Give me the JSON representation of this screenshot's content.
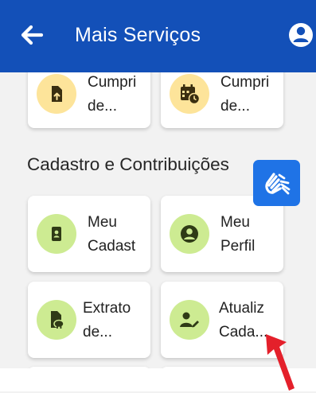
{
  "appbar": {
    "title": "Mais Serviços",
    "back_icon": "arrow-left-icon",
    "profile_icon": "account-circle-icon"
  },
  "top_row": [
    {
      "line1": "Cumpri",
      "line2": "de...",
      "icon": "file-upload-icon"
    },
    {
      "line1": "Cumpri",
      "line2": "de...",
      "icon": "calendar-clock-icon"
    }
  ],
  "section": {
    "title": "Cadastro e Contribuições"
  },
  "cards": [
    {
      "line1": "Meu",
      "line2": "Cadast",
      "icon": "id-card-icon"
    },
    {
      "line1": "Meu",
      "line2": "Perfil",
      "icon": "account-circle-icon"
    },
    {
      "line1": "Extrato",
      "line2": "de...",
      "icon": "document-piggy-bank-icon"
    },
    {
      "line1": "Atualiz",
      "line2": "Cada...",
      "icon": "user-edit-icon"
    }
  ],
  "colors": {
    "appbar": "#1350b8",
    "icon_orange_bg": "#fde49a",
    "icon_green_bg": "#cdeb92",
    "icon_fg": "#2f3b16",
    "libras_button": "#1f73e6",
    "annotation_arrow": "#e4202b"
  },
  "accessibility_button": {
    "icon": "sign-language-hands-icon"
  }
}
